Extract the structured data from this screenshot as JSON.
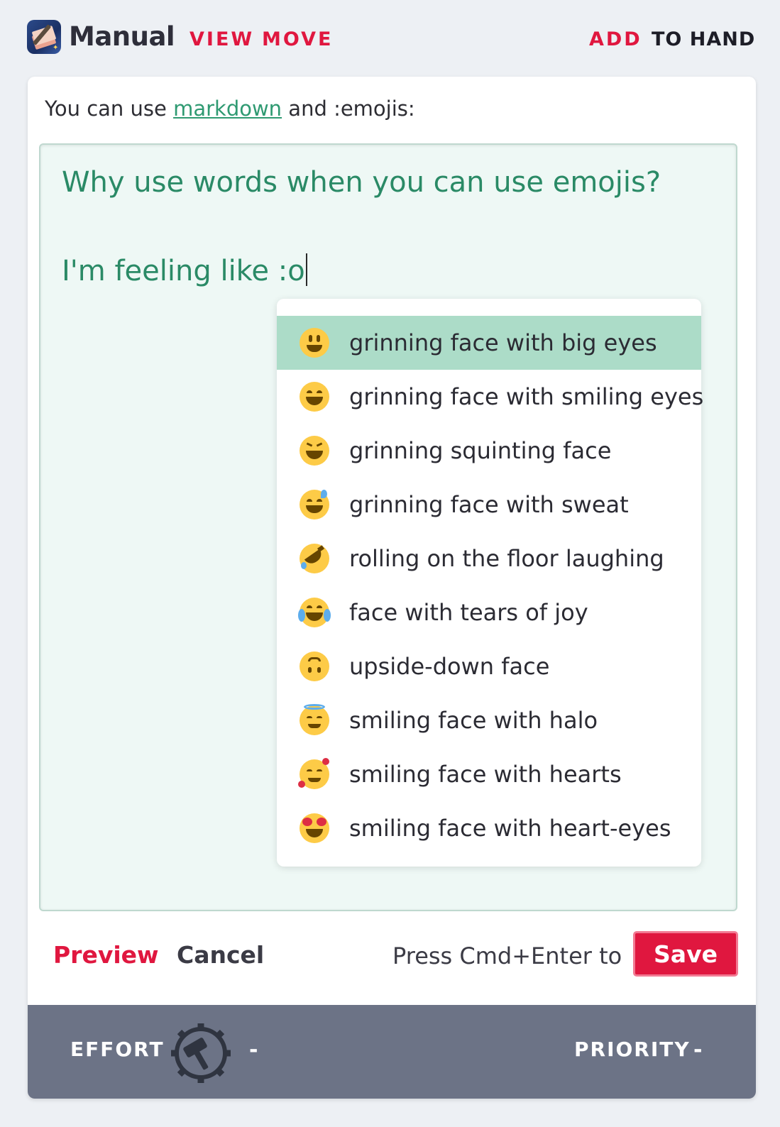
{
  "header": {
    "app_name": "Manual",
    "logo_icon": "notebook-pen-icon",
    "nav": {
      "view": "VIEW",
      "move": "MOVE",
      "add": "ADD",
      "to_hand": "TO HAND"
    }
  },
  "editor_card": {
    "hint_prefix": "You can use",
    "hint_link": "markdown",
    "hint_suffix": "and :emojis:",
    "text_line1": "Why use words when you can use emojis?",
    "text_line2": "I'm feeling like :o"
  },
  "emoji_suggestions": [
    {
      "label": "grinning face with big eyes",
      "icon": "grinning-face-with-big-eyes-icon",
      "selected": true
    },
    {
      "label": "grinning face with smiling eyes",
      "icon": "grinning-face-with-smiling-eyes-icon"
    },
    {
      "label": "grinning squinting face",
      "icon": "grinning-squinting-face-icon"
    },
    {
      "label": "grinning face with sweat",
      "icon": "grinning-face-with-sweat-icon"
    },
    {
      "label": "rolling on the floor laughing",
      "icon": "rolling-on-floor-laughing-icon"
    },
    {
      "label": "face with tears of joy",
      "icon": "face-with-tears-of-joy-icon"
    },
    {
      "label": "upside-down face",
      "icon": "upside-down-face-icon"
    },
    {
      "label": "smiling face with halo",
      "icon": "smiling-face-with-halo-icon"
    },
    {
      "label": "smiling face with hearts",
      "icon": "smiling-face-with-hearts-icon"
    },
    {
      "label": "smiling face with heart-eyes",
      "icon": "smiling-face-with-heart-eyes-icon"
    }
  ],
  "actions": {
    "preview": "Preview",
    "cancel": "Cancel",
    "press_hint": "Press Cmd+Enter to",
    "save": "Save"
  },
  "footer": {
    "effort_label": "EFFORT",
    "effort_value": "-",
    "effort_icon": "hammer-gear-icon",
    "priority_label": "PRIORITY",
    "priority_value": "-"
  },
  "colors": {
    "accent": "#e0173f",
    "editor_text": "#2a8a66",
    "selection": "#acdcc8",
    "footer_bg": "#6c7386"
  }
}
